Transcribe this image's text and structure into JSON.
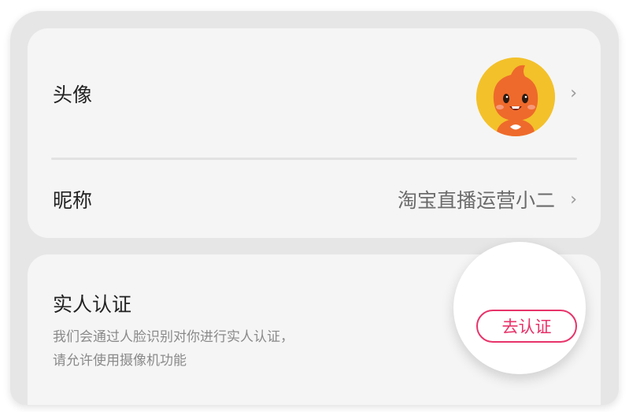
{
  "profile": {
    "avatar_label": "头像",
    "nickname_label": "昵称",
    "nickname_value": "淘宝直播运营小二",
    "chevron": "›"
  },
  "verification": {
    "title": "实人认证",
    "description_line1": "我们会通过人脸识别对你进行实人认证，",
    "description_line2": "请允许使用摄像机功能",
    "button_label": "去认证"
  },
  "colors": {
    "accent": "#e8336a",
    "card_bg": "#f5f5f5",
    "frame_bg": "#e6e6e6",
    "avatar_bg": "#f3c12a"
  }
}
